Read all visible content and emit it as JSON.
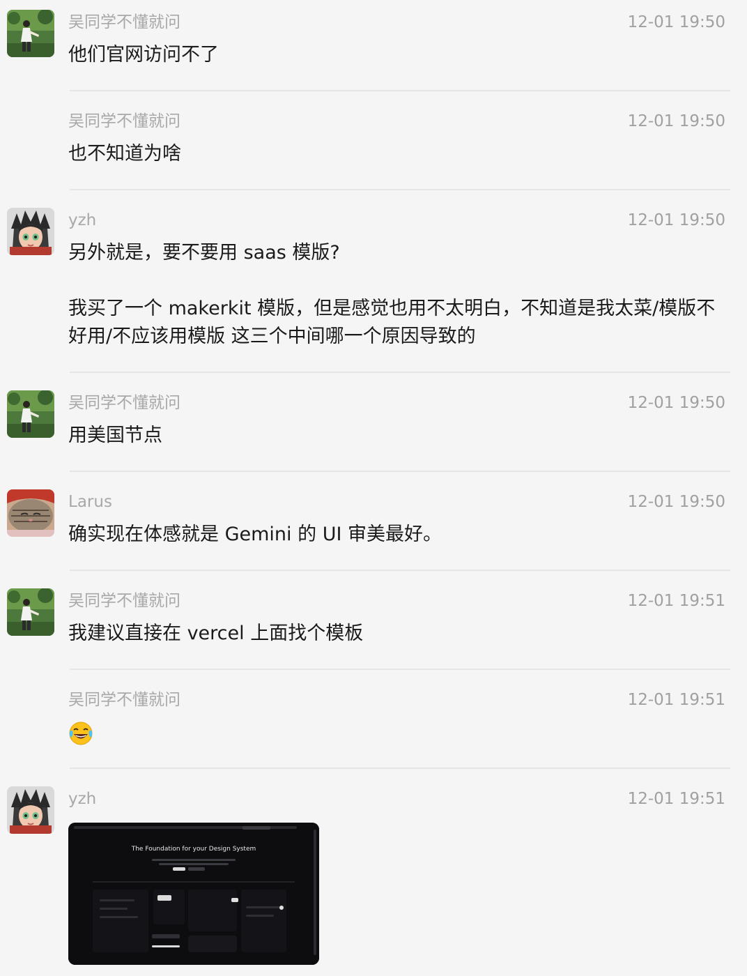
{
  "messages": [
    {
      "sender": "吴同学不懂就问",
      "time": "12-01 19:50",
      "text": "他们官网访问不了",
      "avatar": "avatar-wu"
    },
    {
      "sender": "吴同学不懂就问",
      "time": "12-01 19:50",
      "text": "也不知道为啥"
    },
    {
      "sender": "yzh",
      "time": "12-01 19:50",
      "text": "另外就是，要不要用 saas 模版?\n\n我买了一个 makerkit 模版，但是感觉也用不太明白，不知道是我太菜/模版不好用/不应该用模版 这三个中间哪一个原因导致的",
      "avatar": "avatar-yzh"
    },
    {
      "sender": "吴同学不懂就问",
      "time": "12-01 19:50",
      "text": "用美国节点",
      "avatar": "avatar-wu"
    },
    {
      "sender": "Larus",
      "time": "12-01 19:50",
      "text": "确实现在体感就是 Gemini 的 UI 审美最好。",
      "avatar": "avatar-larus"
    },
    {
      "sender": "吴同学不懂就问",
      "time": "12-01 19:51",
      "text": "我建议直接在 vercel 上面找个模板",
      "avatar": "avatar-wu"
    },
    {
      "sender": "吴同学不懂就问",
      "time": "12-01 19:51",
      "emoji": "face-with-tears-of-joy-icon"
    },
    {
      "sender": "yzh",
      "time": "12-01 19:51",
      "image": {
        "title": "The Foundation for your Design System"
      },
      "avatar": "avatar-yzh"
    }
  ]
}
